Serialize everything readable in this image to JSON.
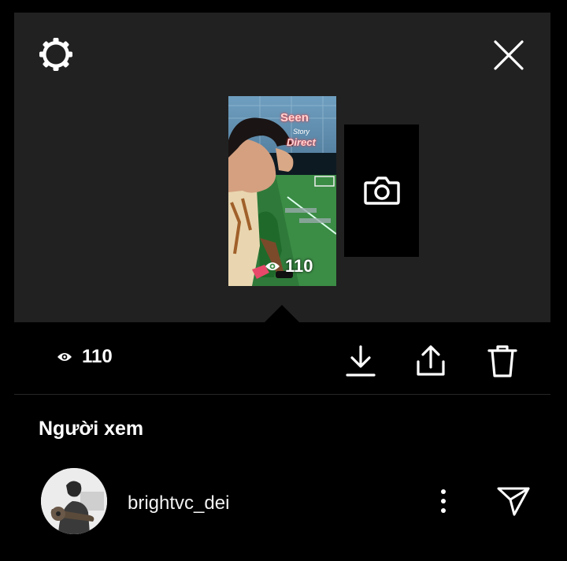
{
  "header": {
    "settings_icon": "gear-icon",
    "close_icon": "close-icon"
  },
  "story_thumbnail": {
    "overlay_line1": "Seen",
    "overlay_line2": "Story",
    "overlay_line3": "Direct",
    "view_count": "110"
  },
  "add_story": {
    "icon": "camera-icon"
  },
  "action_bar": {
    "view_count": "110",
    "icons": [
      "eye-icon",
      "download-icon",
      "share-icon",
      "trash-icon"
    ]
  },
  "viewers": {
    "title": "Người xem",
    "items": [
      {
        "username": "brightvc_dei",
        "icons": [
          "more-vertical-icon",
          "send-icon"
        ]
      }
    ]
  },
  "colors": {
    "background": "#000000",
    "panel": "#212121",
    "text": "#ffffff",
    "overlay_accent": "#e33333"
  }
}
